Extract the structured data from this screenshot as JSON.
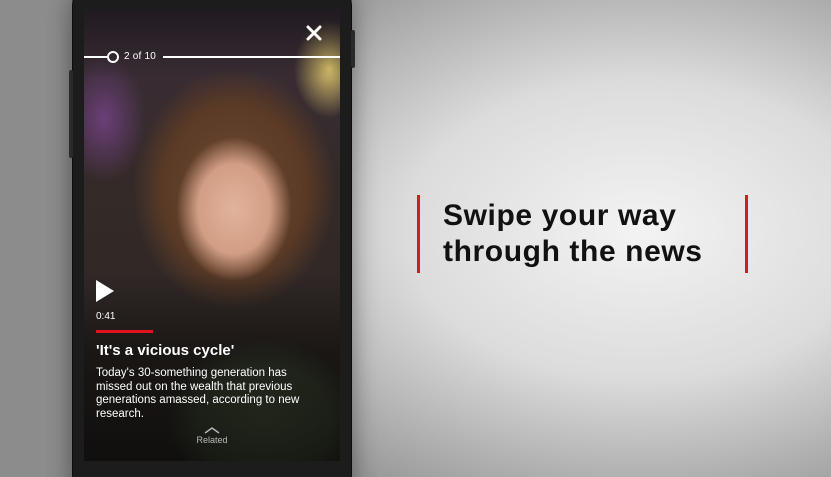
{
  "player": {
    "progress": {
      "current": 2,
      "total": 10,
      "label": "2 of 10"
    },
    "duration": "0:41",
    "headline": "'It's a vicious cycle'",
    "summary": "Today's 30-something generation has missed out on the wealth that previous generations amassed, according to new research.",
    "related_label": "Related",
    "icons": {
      "close": "close-icon",
      "play": "play-icon",
      "related": "chevron-up-icon"
    }
  },
  "tagline": {
    "line1": "Swipe your way",
    "line2": "through the news"
  },
  "colors": {
    "accent_red": "#e0121b",
    "tagline_bar": "#d31c1c",
    "text_dark": "#111111"
  }
}
